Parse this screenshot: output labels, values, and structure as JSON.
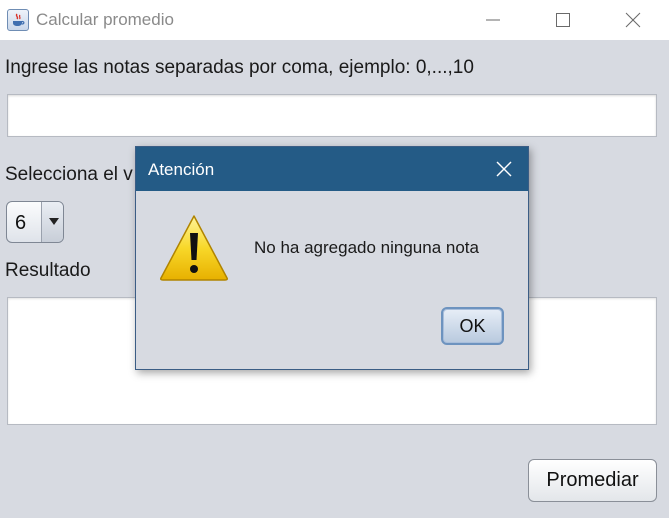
{
  "window": {
    "title": "Calcular promedio",
    "icon": "java-cup-icon"
  },
  "form": {
    "notas_label": "Ingrese las notas separadas por coma, ejemplo: 0,...,10",
    "notas_value": "",
    "select_label": "Selecciona el v",
    "select_value": "6",
    "result_label": "Resultado",
    "result_value": "",
    "promediar_label": "Promediar"
  },
  "dialog": {
    "title": "Atención",
    "message": "No ha agregado ninguna nota",
    "ok_label": "OK",
    "icon": "warning-icon"
  },
  "colors": {
    "dialog_titlebar": "#245b86",
    "background": "#d7dae1",
    "warning_yellow": "#f4cf18"
  }
}
